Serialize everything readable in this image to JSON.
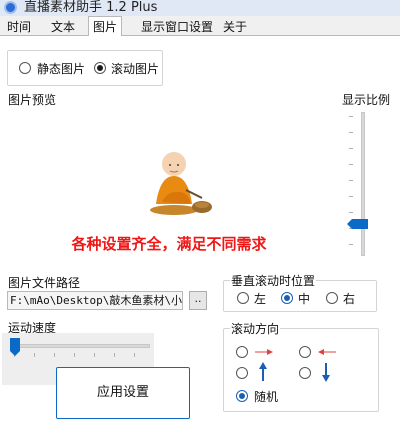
{
  "window": {
    "title": "直播素材助手 1.2 Plus"
  },
  "tabs": [
    {
      "label": "时间"
    },
    {
      "label": "文本"
    },
    {
      "label": "图片"
    },
    {
      "label": "显示窗口设置"
    },
    {
      "label": "关于"
    }
  ],
  "active_tab": "图片",
  "image_mode": {
    "static_label": "静态图片",
    "scroll_label": "滚动图片",
    "selected": "scroll"
  },
  "preview": {
    "label": "图片预览",
    "banner_text": "各种设置齐全，满足不同需求"
  },
  "scale": {
    "label": "显示比例",
    "level_fraction": 0.75
  },
  "file_path": {
    "label": "图片文件路径",
    "value": "F:\\mAo\\Desktop\\敲木鱼素材\\小",
    "browse_label": ".."
  },
  "vertical_position": {
    "label": "垂直滚动时位置",
    "options": [
      "左",
      "中",
      "右"
    ],
    "selected": "中"
  },
  "speed": {
    "label": "运动速度",
    "level_fraction": 0.02
  },
  "direction": {
    "label": "滚动方向",
    "random_label": "随机",
    "selected": "random"
  },
  "colors": {
    "accent": "#0b69c7",
    "banner": "#f01616",
    "arrow_red": "#e04040",
    "arrow_blue": "#1a5fb4"
  },
  "apply_button": {
    "label": "应用设置"
  }
}
